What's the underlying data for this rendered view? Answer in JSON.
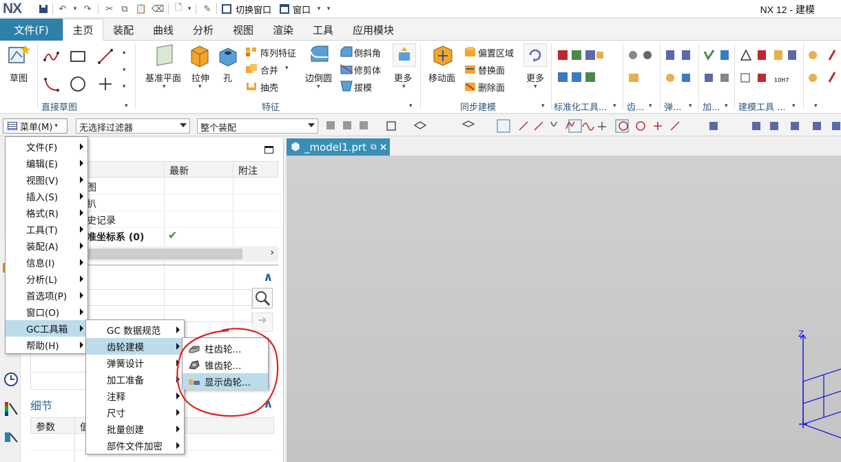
{
  "app": {
    "logo": "NX",
    "title": "NX 12 - 建模",
    "switch_window": "切换窗口",
    "window": "窗口"
  },
  "tabs": {
    "file": "文件(F)",
    "items": [
      "主页",
      "装配",
      "曲线",
      "分析",
      "视图",
      "渲染",
      "工具",
      "应用模块"
    ]
  },
  "ribbon": {
    "sketch_label": "草图",
    "groups": [
      "直接草图",
      "特征",
      "同步建模",
      "标准化工具...",
      "齿...",
      "弹...",
      "加...",
      "建模工具 ..."
    ],
    "feature_buttons": [
      "基准平面",
      "拉伸",
      "孔",
      "边倒圆",
      "更多"
    ],
    "feature_small": [
      "阵列特征",
      "合并",
      "抽壳",
      "倒斜角",
      "修剪体",
      "拔模"
    ],
    "sync_buttons": [
      "移动面",
      "更多"
    ],
    "sync_small": [
      "偏置区域",
      "替换面",
      "删除面"
    ]
  },
  "toolbar": {
    "menu": "菜单(M)",
    "filter": "无选择过滤器",
    "scope": "整个装配"
  },
  "navigator": {
    "columns": [
      "最新",
      "附注"
    ],
    "rows": [
      {
        "name": "图",
        "latest": ""
      },
      {
        "name": "扒",
        "latest": ""
      },
      {
        "name": "史记录",
        "latest": ""
      },
      {
        "name": "准坐标系 (0)",
        "latest": "✔"
      }
    ],
    "details_title": "细节",
    "details_columns": [
      "参数",
      "值"
    ]
  },
  "document": {
    "tab": "_model1.prt"
  },
  "main_menu": {
    "items": [
      "文件(F)",
      "编辑(E)",
      "视图(V)",
      "插入(S)",
      "格式(R)",
      "工具(T)",
      "装配(A)",
      "信息(I)",
      "分析(L)",
      "首选项(P)",
      "窗口(O)",
      "GC工具箱",
      "帮助(H)"
    ]
  },
  "gc_menu": {
    "items": [
      "GC 数据规范",
      "齿轮建模",
      "弹簧设计",
      "加工准备",
      "注释",
      "尺寸",
      "批量创建",
      "部件文件加密"
    ]
  },
  "gear_menu": {
    "items": [
      "柱齿轮...",
      "锥齿轮...",
      "显示齿轮..."
    ]
  },
  "viewport": {
    "axis_label": "Z"
  },
  "colors": {
    "accent": "#2e80a8",
    "doc_tab": "#3a8fb6",
    "menu_highlight": "#bcdceb",
    "annotation": "#e02020"
  }
}
